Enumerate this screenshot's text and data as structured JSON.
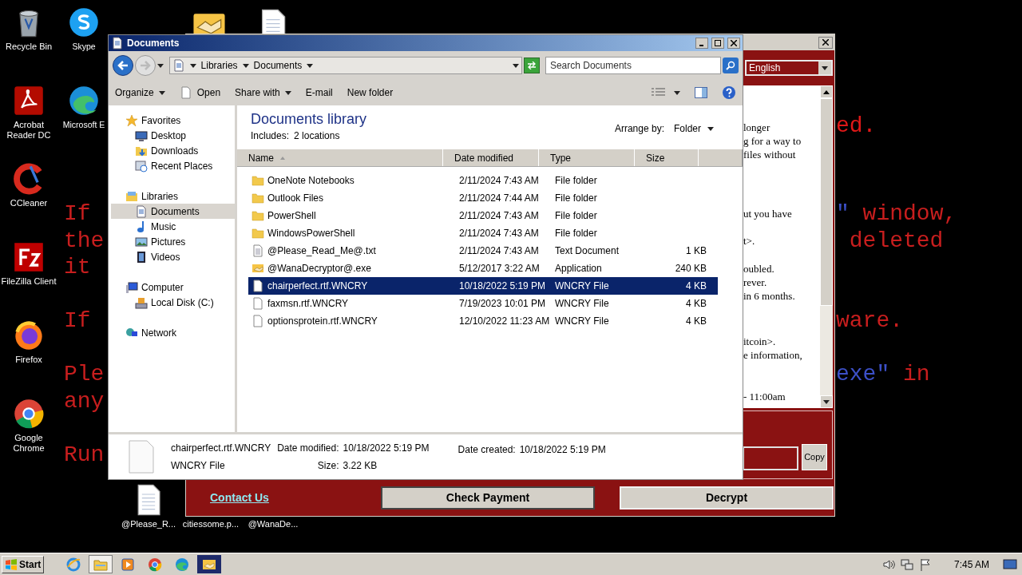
{
  "desktop": {
    "icons": [
      {
        "label": "Recycle Bin",
        "kind": "recycle"
      },
      {
        "label": "Acrobat Reader DC",
        "kind": "acrobat"
      },
      {
        "label": "CCleaner",
        "kind": "ccleaner"
      },
      {
        "label": "FileZilla Client",
        "kind": "filezilla"
      },
      {
        "label": "Firefox",
        "kind": "firefox"
      },
      {
        "label": "Google Chrome",
        "kind": "chrome"
      }
    ],
    "icons_column_2": [
      {
        "label": "Skype",
        "kind": "skype"
      },
      {
        "label": "Microsoft E",
        "kind": "edge"
      }
    ],
    "icons_top": [
      {
        "kind": "handshake"
      },
      {
        "kind": "file"
      }
    ],
    "icons_bottom": [
      {
        "label": "@Please_R...",
        "kind": "file"
      },
      {
        "label": "citiessome.p...",
        "kind": "covered"
      },
      {
        "label": "@WanaDe...",
        "kind": "covered"
      }
    ]
  },
  "wallpaper": {
    "left": [
      [
        [
          {
            "text": "If",
            "color": "#c81e1e"
          }
        ],
        [
          {
            "text": "the",
            "color": "#c81e1e"
          }
        ],
        [
          {
            "text": "it",
            "color": "#c81e1e"
          }
        ]
      ],
      [
        [
          {
            "text": "If",
            "color": "#c81e1e"
          }
        ]
      ],
      [
        [
          {
            "text": "Ple",
            "color": "#c81e1e"
          }
        ],
        [
          {
            "text": "any",
            "color": "#c81e1e"
          }
        ]
      ],
      [
        [
          {
            "text": "Run",
            "color": "#c81e1e"
          }
        ]
      ]
    ],
    "right": [
      [
        [
          {
            "text": "ed.",
            "color": "#e01818"
          }
        ]
      ],
      [
        [
          {
            "text": "\"",
            "color": "#3c50c8"
          },
          {
            "text": " window,",
            "color": "#c81e1e"
          }
        ],
        [
          {
            "text": " deleted",
            "color": "#c81e1e"
          }
        ]
      ],
      [
        [
          {
            "text": "ware.",
            "color": "#c81e1e"
          }
        ]
      ],
      [
        [
          {
            "text": "exe\"",
            "color": "#3c50c8"
          },
          {
            "text": " in",
            "color": "#c81e1e"
          }
        ]
      ]
    ]
  },
  "ransom_window": {
    "language": "English",
    "message": [
      [
        "longer",
        "g for a way to",
        "files without"
      ],
      [
        "ut you have"
      ],
      [
        "t>."
      ],
      [
        "oubled.",
        "rever.",
        "in 6 months."
      ],
      [
        "itcoin>.",
        "e information,"
      ],
      [
        "- 11:00am"
      ]
    ],
    "copy_button": "Copy",
    "contact_link": "Contact Us",
    "buttons": [
      "Check Payment",
      "Decrypt"
    ]
  },
  "explorer": {
    "title": "Documents",
    "breadcrumb": [
      "Libraries",
      "Documents"
    ],
    "search_placeholder": "Search Documents",
    "toolbar": [
      {
        "label": "Organize",
        "dropdown": true,
        "kind": "menu"
      },
      {
        "label": "Open",
        "dropdown": false,
        "kind": "open"
      },
      {
        "label": "Share with",
        "dropdown": true,
        "kind": "menu"
      },
      {
        "label": "E-mail",
        "dropdown": false,
        "kind": "menu"
      },
      {
        "label": "New folder",
        "dropdown": false,
        "kind": "menu"
      }
    ],
    "nav": [
      {
        "label": "Favorites",
        "kind": "star",
        "selected": false,
        "children": [
          {
            "label": "Desktop",
            "kind": "desktop",
            "selected": false
          },
          {
            "label": "Downloads",
            "kind": "downloads",
            "selected": false
          },
          {
            "label": "Recent Places",
            "kind": "recent",
            "selected": false
          }
        ]
      },
      {
        "label": "Libraries",
        "kind": "libraries",
        "selected": false,
        "children": [
          {
            "label": "Documents",
            "kind": "documents",
            "selected": true
          },
          {
            "label": "Music",
            "kind": "music",
            "selected": false
          },
          {
            "label": "Pictures",
            "kind": "pictures",
            "selected": false
          },
          {
            "label": "Videos",
            "kind": "videos",
            "selected": false
          }
        ]
      },
      {
        "label": "Computer",
        "kind": "computer",
        "selected": false,
        "children": [
          {
            "label": "Local Disk (C:)",
            "kind": "disk",
            "selected": false
          }
        ]
      },
      {
        "label": "Network",
        "kind": "network",
        "selected": false
      }
    ],
    "library_title": "Documents library",
    "includes_label": "Includes:",
    "includes_value": "2 locations",
    "arrange_label": "Arrange by:",
    "arrange_value": "Folder",
    "columns": [
      {
        "label": "Name",
        "sorted": true
      },
      {
        "label": "Date modified",
        "sorted": false
      },
      {
        "label": "Type",
        "sorted": false
      },
      {
        "label": "Size",
        "sorted": false
      }
    ],
    "files": [
      {
        "name": "OneNote Notebooks",
        "date": "2/11/2024 7:43 AM",
        "type": "File folder",
        "kind": "folder",
        "selected": false
      },
      {
        "name": "Outlook Files",
        "date": "2/11/2024 7:44 AM",
        "type": "File folder",
        "kind": "folder",
        "selected": false
      },
      {
        "name": "PowerShell",
        "date": "2/11/2024 7:43 AM",
        "type": "File folder",
        "kind": "folder",
        "selected": false
      },
      {
        "name": "WindowsPowerShell",
        "date": "2/11/2024 7:43 AM",
        "type": "File folder",
        "kind": "folder",
        "selected": false
      },
      {
        "name": "@Please_Read_Me@.txt",
        "date": "2/11/2024 7:43 AM",
        "type": "Text Document",
        "size": "1 KB",
        "kind": "text",
        "selected": false
      },
      {
        "name": "@WanaDecryptor@.exe",
        "date": "5/12/2017 3:22 AM",
        "type": "Application",
        "size": "240 KB",
        "kind": "app",
        "selected": false
      },
      {
        "name": "chairperfect.rtf.WNCRY",
        "date": "10/18/2022 5:19 PM",
        "type": "WNCRY File",
        "size": "4 KB",
        "kind": "blank",
        "selected": true
      },
      {
        "name": "faxmsn.rtf.WNCRY",
        "date": "7/19/2023 10:01 PM",
        "type": "WNCRY File",
        "size": "4 KB",
        "kind": "blank",
        "selected": false
      },
      {
        "name": "optionsprotein.rtf.WNCRY",
        "date": "12/10/2022 11:23 AM",
        "type": "WNCRY File",
        "size": "4 KB",
        "kind": "blank",
        "selected": false
      }
    ],
    "details": {
      "name": "chairperfect.rtf.WNCRY",
      "type": "WNCRY File",
      "date_modified_label": "Date modified:",
      "date_modified": "10/18/2022 5:19 PM",
      "size_label": "Size:",
      "size": "3.22 KB",
      "date_created_label": "Date created:",
      "date_created": "10/18/2022 5:19 PM"
    }
  },
  "taskbar": {
    "start": "Start",
    "apps": [
      {
        "kind": "ie",
        "pressed": false
      },
      {
        "kind": "explorer",
        "pressed": true
      },
      {
        "kind": "media",
        "pressed": false
      },
      {
        "kind": "chrome",
        "pressed": false
      },
      {
        "kind": "edge",
        "pressed": false
      },
      {
        "kind": "handshake",
        "pressed": false
      }
    ],
    "tray": [
      {
        "kind": "speaker"
      },
      {
        "kind": "network"
      },
      {
        "kind": "flag"
      }
    ],
    "time": "7:45 AM"
  }
}
